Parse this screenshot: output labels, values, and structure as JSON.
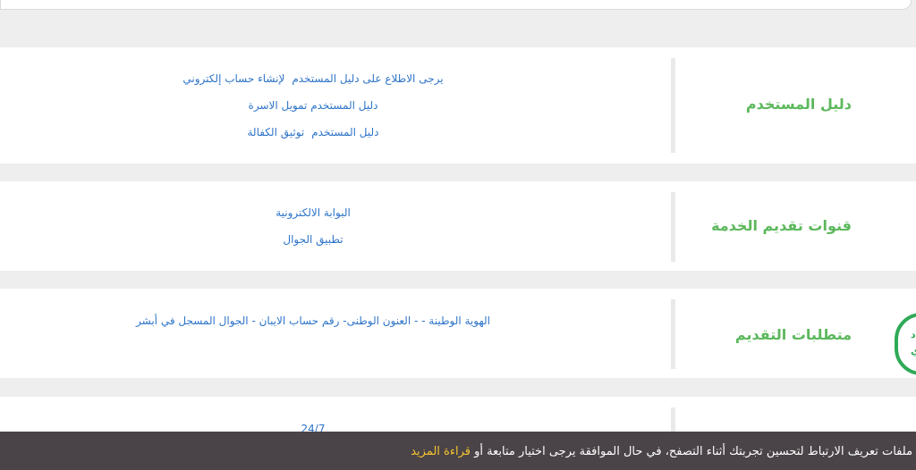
{
  "sections": [
    {
      "heading": "دليل المستخدم",
      "lines": [
        [
          {
            "text": "يرجى الاطلاع على دليل المستخدم",
            "link": false
          },
          {
            "text": "لإنشاء حساب إلكتروني",
            "link": true
          }
        ],
        [
          {
            "text": "دليل المستخدم تمويل الاسرة",
            "link": true
          }
        ],
        [
          {
            "text": "دليل المستخدم",
            "link": true
          },
          {
            "text": "توثيق الكفالة",
            "link": true
          }
        ]
      ]
    },
    {
      "heading": "قنوات تقديم الخدمة",
      "lines": [
        [
          {
            "text": "البوابة الالكترونية",
            "link": true
          }
        ],
        [
          {
            "text": "تطبيق الجوال",
            "link": true
          }
        ]
      ]
    },
    {
      "heading": "متطلبات التقديم",
      "lines": [
        [
          {
            "text": "الهوية الوطينة - - العنون الوطنى- رقم حساب الايبان - الجوال المسجل في أبشر",
            "link": false
          }
        ]
      ]
    },
    {
      "heading": "",
      "lines": [
        [
          {
            "text": "24/7",
            "link": false
          }
        ]
      ]
    }
  ],
  "whatsapp": {
    "line1": "د",
    "line2": "ي"
  },
  "cookie_banner": {
    "text": "دم ملفات تعريف الارتباط لتحسين تجربتك أثناء التصفح، في حال الموافقة يرجى اختيار متابعة أو",
    "more_link": "قراءة المزيد"
  },
  "colors": {
    "heading": "#5cb85c",
    "link": "#2e74c8",
    "whatsapp": "#2eaa57",
    "cookie_bg": "#4a4347",
    "cookie_link": "#f4c430"
  }
}
